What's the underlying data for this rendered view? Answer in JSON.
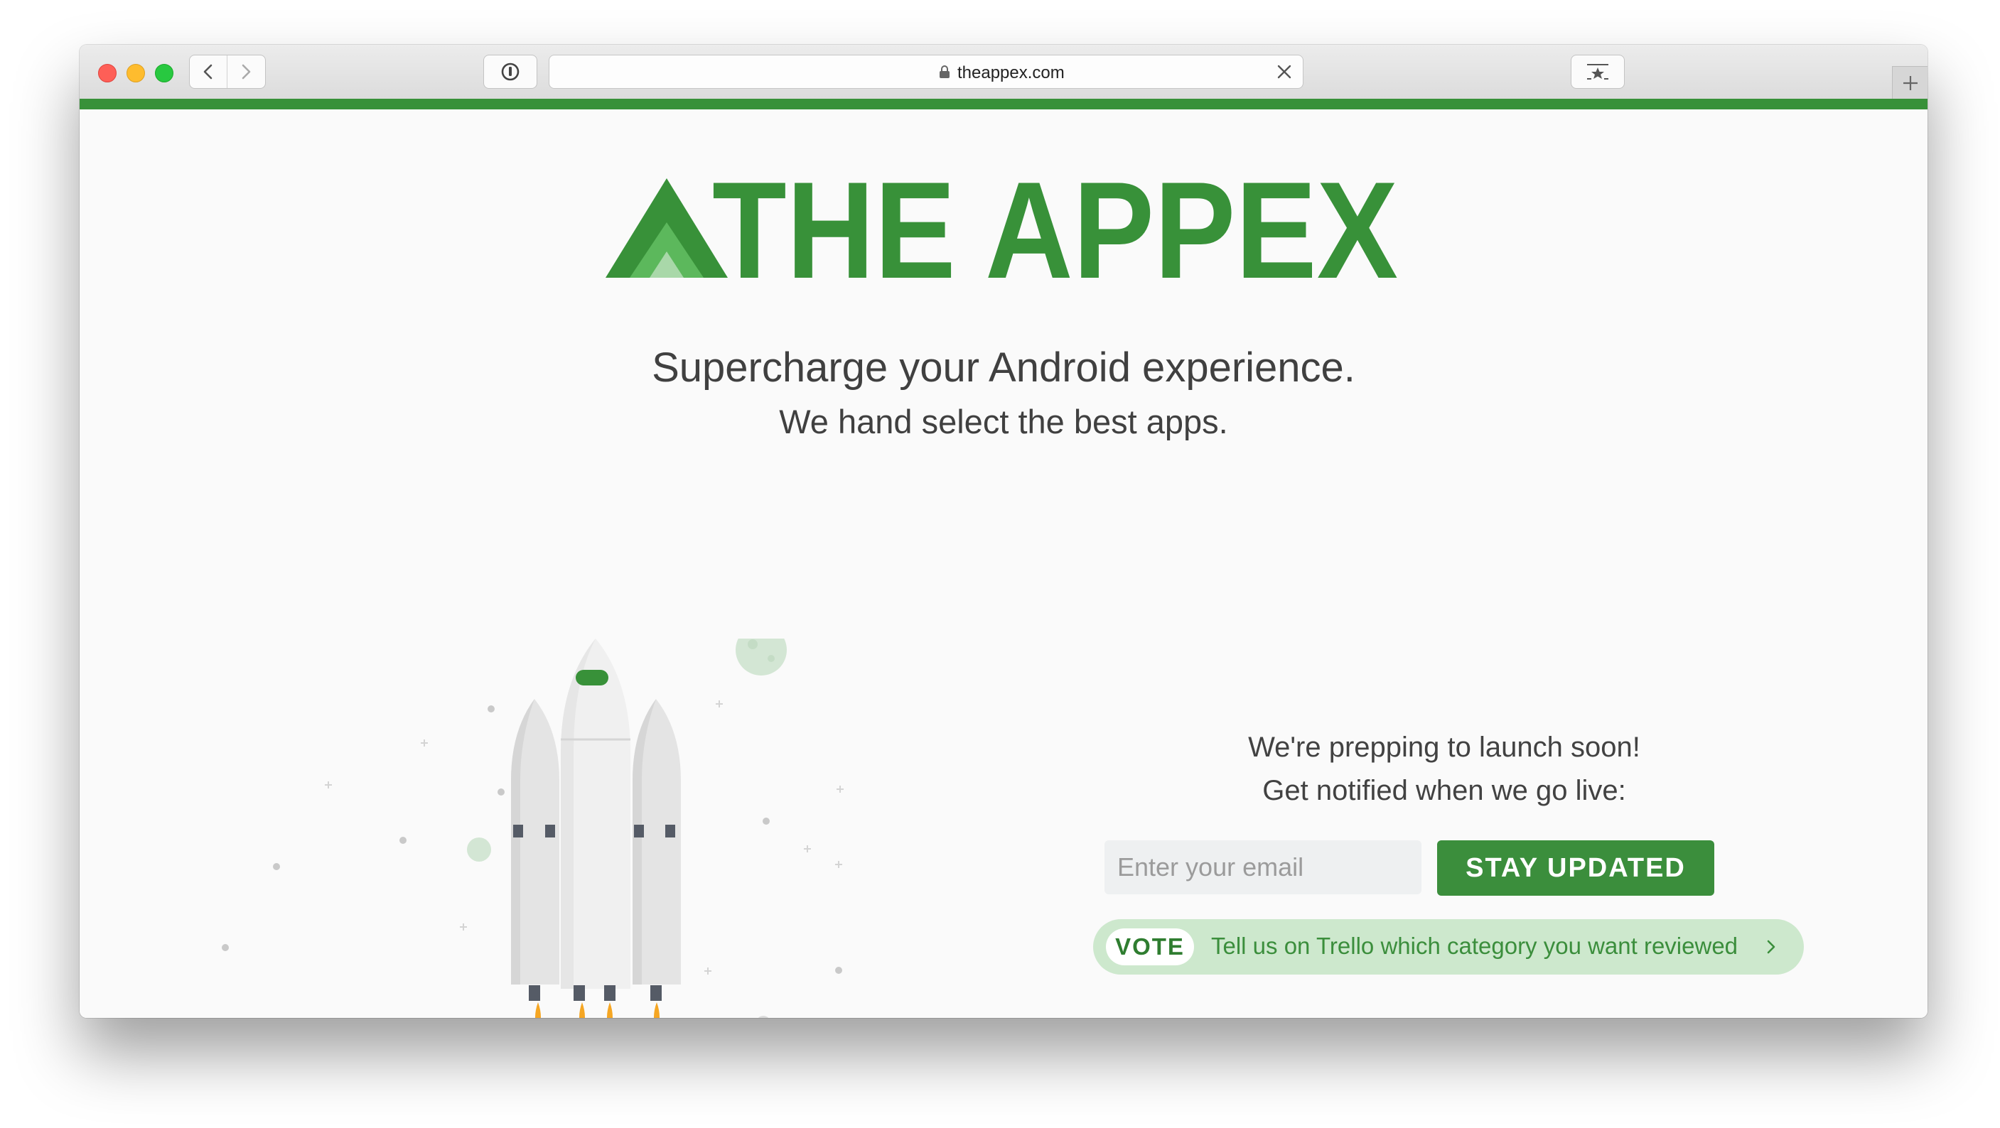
{
  "browser": {
    "url": "theappex.com"
  },
  "logo": {
    "text": "THE APPEX",
    "color": "#389139"
  },
  "hero": {
    "tagline": "Supercharge your Android experience.",
    "subtagline": "We hand select the best apps."
  },
  "signup": {
    "line1": "We're prepping to launch soon!",
    "line2": "Get notified when we go live:",
    "email_placeholder": "Enter your email",
    "button_label": "STAY UPDATED"
  },
  "vote": {
    "badge": "VOTE",
    "text": "Tell us on Trello which category you want reviewed",
    "chevron_icon": "chevron-right-icon"
  },
  "colors": {
    "brand_green": "#389139",
    "light_green": "#cde8cd"
  }
}
